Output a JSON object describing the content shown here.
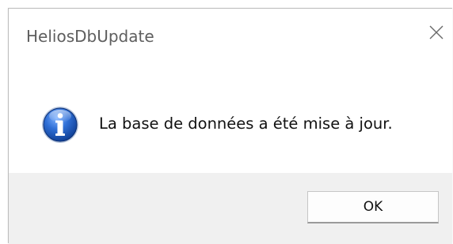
{
  "window": {
    "title": "HeliosDbUpdate",
    "close_icon": "close-icon"
  },
  "message": {
    "icon": "info-icon",
    "text": "La base de données a été mise à jour."
  },
  "buttons": {
    "ok_label": "OK"
  },
  "colors": {
    "title_text": "#5e5e5e",
    "footer_bg": "#f0f0f0",
    "icon_blue": "#1c56b5"
  }
}
